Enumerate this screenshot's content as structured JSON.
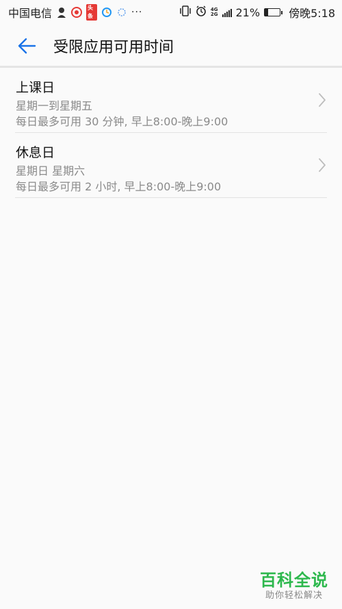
{
  "status_bar": {
    "carrier": "中国电信",
    "notification_badge": "头条",
    "more": "···",
    "network_top": "4G",
    "network_bottom": "2G",
    "battery_percent": "21%",
    "battery_level": 0.21,
    "time": "傍晚5:18"
  },
  "header": {
    "title": "受限应用可用时间",
    "accent_color": "#1a73e8"
  },
  "list": {
    "items": [
      {
        "title": "上课日",
        "days": "星期一到星期五",
        "limit": "每日最多可用 30 分钟, 早上8:00-晚上9:00"
      },
      {
        "title": "休息日",
        "days": "星期日 星期六",
        "limit": "每日最多可用 2 小时, 早上8:00-晚上9:00"
      }
    ]
  },
  "watermark": {
    "brand": "百科全说",
    "slogan": "助你轻松解决"
  }
}
